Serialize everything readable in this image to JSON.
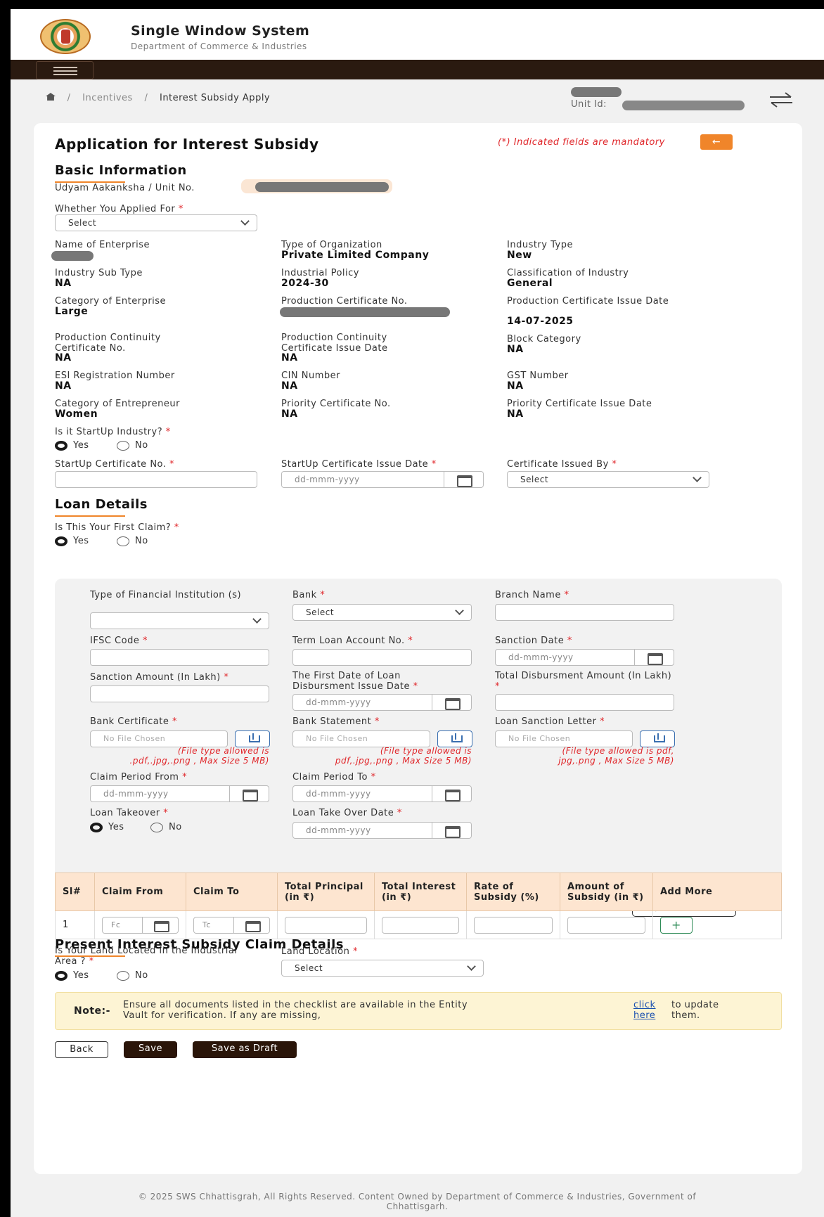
{
  "header": {
    "title": "Single Window System",
    "subtitle": "Department of Commerce & Industries"
  },
  "breadcrumb": {
    "item1": "Incentives",
    "item2": "Interest Subsidy Apply",
    "sep": "/"
  },
  "unit": {
    "label": "Unit Id:"
  },
  "form": {
    "title": "Application for Interest Subsidy",
    "mandatory_note": "(*) Indicated fields are mandatory",
    "back_arrow": "←"
  },
  "basic": {
    "heading": "Basic Information",
    "udyam_label": "Udyam Aakanksha / Unit No.",
    "applied_for_label": "Whether You Applied For",
    "applied_for_value": "Select",
    "fields": [
      {
        "label": "Name of Enterprise",
        "value": ""
      },
      {
        "label": "Type of Organization",
        "value": "Private Limited Company"
      },
      {
        "label": "Industry Type",
        "value": "New"
      },
      {
        "label": "Industry Sub Type",
        "value": "NA"
      },
      {
        "label": "Industrial Policy",
        "value": "2024-30"
      },
      {
        "label": "Classification of Industry",
        "value": "General"
      },
      {
        "label": "Category of Enterprise",
        "value": "Large"
      },
      {
        "label": "Production Certificate No.",
        "value": ""
      },
      {
        "label": "Production Certificate Issue Date",
        "value": "14-07-2025"
      },
      {
        "label": "Production Continuity Certificate No.",
        "value": "NA"
      },
      {
        "label": "Production Continuity Certificate Issue Date",
        "value": "NA"
      },
      {
        "label": "Block Category",
        "value": "NA"
      },
      {
        "label": "ESI Registration Number",
        "value": "NA"
      },
      {
        "label": "CIN Number",
        "value": "NA"
      },
      {
        "label": "GST Number",
        "value": "NA"
      },
      {
        "label": "Category of Entrepreneur",
        "value": "Women"
      },
      {
        "label": "Priority Certificate No.",
        "value": "NA"
      },
      {
        "label": "Priority Certificate Issue Date",
        "value": "NA"
      }
    ],
    "startup_q": "Is it StartUp Industry?",
    "yes": "Yes",
    "no": "No",
    "startup_cert_label": "StartUp Certificate No.",
    "startup_date_label": "StartUp Certificate Issue Date",
    "cert_issued_label": "Certificate Issued By",
    "select": "Select",
    "date_placeholder": "dd-mmm-yyyy"
  },
  "loan": {
    "heading": "Loan Details",
    "first_claim_q": "Is This Your First Claim?",
    "fin_inst_label": "Type of Financial Institution (s)",
    "bank_label": "Bank",
    "branch_label": "Branch Name",
    "ifsc_label": "IFSC Code",
    "term_loan_label": "Term Loan Account No.",
    "sanction_date_label": "Sanction Date",
    "sanction_amt_label": "Sanction Amount (In Lakh)",
    "first_disb_label": "The First Date of Loan Disbursment Issue Date",
    "total_disb_label": "Total Disbursment Amount (In Lakh)",
    "bank_cert_label": "Bank Certificate",
    "bank_stmt_label": "Bank Statement",
    "sanction_letter_label": "Loan Sanction Letter",
    "no_file": "No File Chosen",
    "hint1_l1": "(File type allowed is",
    "hint1_l2": ".pdf,.jpg,.png , Max Size 5 MB)",
    "hint2_l1": "(File type allowed is",
    "hint2_l2": "pdf,.jpg,.png , Max Size 5 MB)",
    "hint3_l1": "(File type allowed is pdf,",
    "hint3_l2": "jpg,.png , Max Size 5 MB)",
    "claim_from_label": "Claim Period From",
    "claim_to_label": "Claim Period To",
    "takeover_label": "Loan Takeover",
    "takeover_date_label": "Loan Take Over Date",
    "add_more": "⊕ Add More"
  },
  "claims": {
    "heading": "Present Interest Subsidy Claim Details",
    "columns": [
      "Sl#",
      "Claim From",
      "Claim To",
      "Total Principal (in ₹)",
      "Total Interest (in ₹)",
      "Rate of Subsidy (%)",
      "Amount of Subsidy (in ₹)",
      "Add More"
    ],
    "row": {
      "sl": "1",
      "from_ph": "Fc",
      "to_ph": "Tc",
      "add": "+"
    }
  },
  "land": {
    "question": "Is Your Land Located in the Industrial Area ?",
    "location_label": "Land Location",
    "location_value": "Select"
  },
  "note": {
    "label": "Note:-",
    "text1": "Ensure all documents listed in the checklist are available in the Entity",
    "text2": "Vault for verification. If any are missing,",
    "link1": "click",
    "link2": "here",
    "tail1": "to update",
    "tail2": "them."
  },
  "buttons": {
    "back": "Back",
    "save": "Save",
    "draft": "Save as Draft"
  },
  "footer": {
    "l1": "© 2025 SWS Chhattisgrah, All Rights Reserved. Content Owned by Department of Commerce & Industries, Government of",
    "l2": "Chhattisgarh."
  }
}
